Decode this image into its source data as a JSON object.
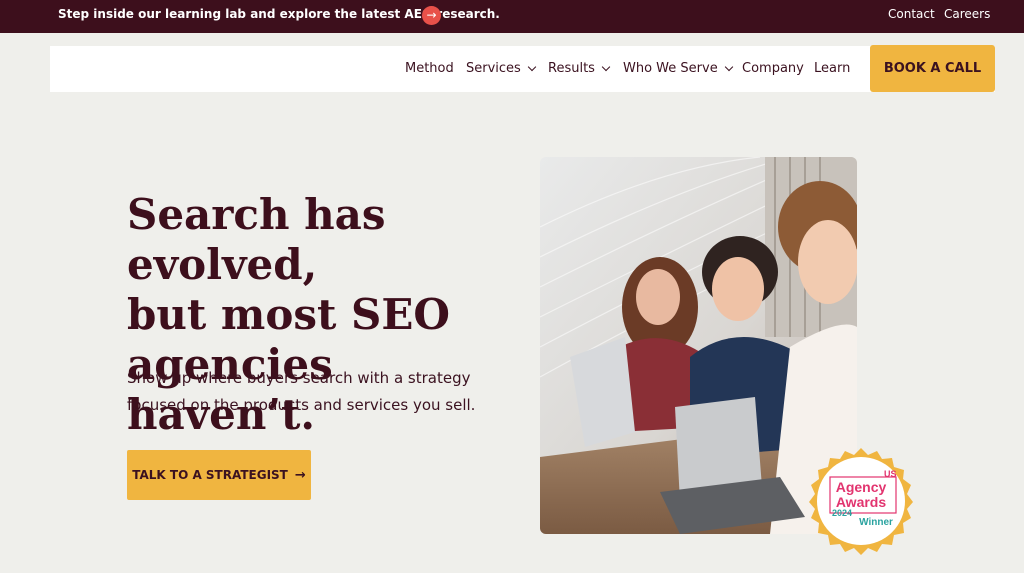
{
  "topbar": {
    "promo_text": "Step inside our learning lab and explore the latest AEO research.",
    "promo_arrow": "→",
    "contact": "Contact",
    "careers": "Careers"
  },
  "nav": {
    "method": "Method",
    "services": "Services",
    "results": "Results",
    "who_we_serve": "Who We Serve",
    "company": "Company",
    "learn": "Learn",
    "book": "BOOK A CALL"
  },
  "hero": {
    "headline_lines": [
      "Search has evolved,",
      "but most SEO",
      "agencies haven’t."
    ],
    "sub_lines": [
      "Show up where buyers search with a strategy",
      "focused on the products and services you sell."
    ],
    "cta_label": "TALK TO A STRATEGIST",
    "cta_arrow": "→"
  },
  "badge": {
    "country": "US",
    "line1": "Agency",
    "line2": "Awards",
    "year": "2024",
    "status": "Winner"
  },
  "colors": {
    "maroon": "#3d0f1c",
    "gold": "#f0b540",
    "background": "#efefeb",
    "promo_arrow": "#e8514a",
    "badge_pink": "#e2346f",
    "badge_teal": "#2aa3a0"
  },
  "icons": {
    "promo_arrow": "arrow-right-icon",
    "nav_dropdown": "chevron-down-icon",
    "cta_arrow": "arrow-right-icon"
  }
}
